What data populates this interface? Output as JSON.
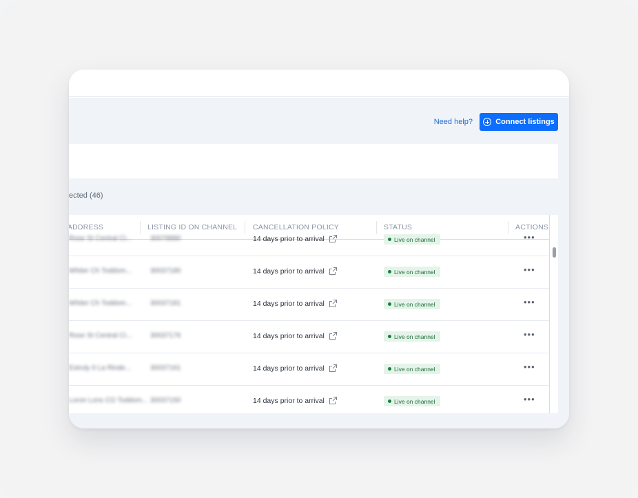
{
  "header": {
    "help_link": "Need help?",
    "connect_button": "Connect listings"
  },
  "selection": {
    "count_text": "ected (46)"
  },
  "table": {
    "columns": [
      "'S ADDRESS",
      "LISTING ID ON CHANNEL",
      "CANCELLATION POLICY",
      "STATUS",
      "ACTIONS"
    ],
    "rows": [
      {
        "address": "Rose St Central Ci...",
        "listing_id": "30078880",
        "policy": "14 days prior to arrival",
        "status": "Live on channel",
        "actions": "•••"
      },
      {
        "address": "Whiter Ch Toddom...",
        "listing_id": "30037180",
        "policy": "14 days prior to arrival",
        "status": "Live on channel",
        "actions": "•••"
      },
      {
        "address": "Whiter Ch Toddom...",
        "listing_id": "30037181",
        "policy": "14 days prior to arrival",
        "status": "Live on channel",
        "actions": "•••"
      },
      {
        "address": "Rose St Central Ci...",
        "listing_id": "30037176",
        "policy": "14 days prior to arrival",
        "status": "Live on channel",
        "actions": "•••"
      },
      {
        "address": "Estruly 6 La Rinde...",
        "listing_id": "30037161",
        "policy": "14 days prior to arrival",
        "status": "Live on channel",
        "actions": "•••"
      },
      {
        "address": "Loron Lons CO Toddom...",
        "listing_id": "30037150",
        "policy": "14 days prior to arrival",
        "status": "Live on channel",
        "actions": "•••"
      }
    ]
  },
  "colors": {
    "accent": "#0d6efd",
    "status_bg": "#e5f4ea",
    "status_text": "#1e6b35",
    "content_bg": "#f0f3f7"
  },
  "icons": {
    "connect": "plus-circle-icon",
    "policy_link": "external-link-icon",
    "actions": "more-horizontal-icon",
    "status": "status-dot-icon"
  }
}
